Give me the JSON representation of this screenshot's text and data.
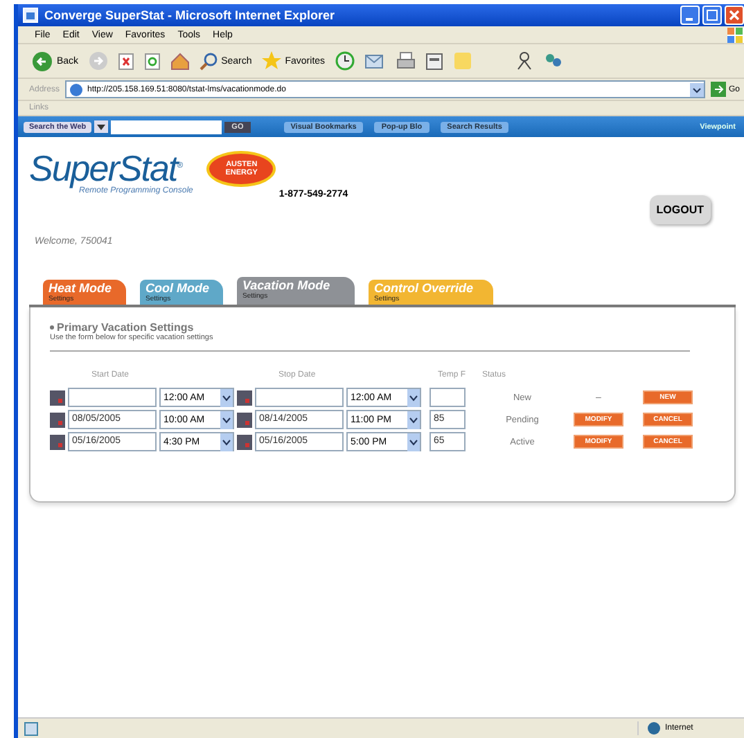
{
  "window": {
    "title": "Converge SuperStat - Microsoft Internet Explorer"
  },
  "menu": [
    "File",
    "Edit",
    "View",
    "Favorites",
    "Tools",
    "Help"
  ],
  "toolbar": {
    "back": "Back",
    "search": "Search",
    "favorites": "Favorites"
  },
  "address": {
    "label": "Address",
    "url": "http://205.158.169.51:8080/tstat-lms/vacationmode.do",
    "go": "Go"
  },
  "links": "Links",
  "search_toolbar": {
    "search_button": "Search the Web",
    "go": "GO",
    "items": [
      "Visual Bookmarks",
      "Pop-up Blo",
      "Search Results"
    ],
    "viewpoint": "Viewpoint"
  },
  "page": {
    "logo": "SuperStat$^{®}$",
    "logo_subtitle": "Remote Programming Console",
    "sponsor": "AUSTEN ENERGY",
    "phone": "1-877-549-2774",
    "logout": "LOGOUT",
    "welcome": "Welcome, 750041",
    "tabs": [
      {
        "label": "Heat Mode",
        "sub": "Settings",
        "color": "#e8692a",
        "selected": false
      },
      {
        "label": "Cool Mode",
        "sub": "Settings",
        "color": "#5fa8c8",
        "selected": false
      },
      {
        "label": "Vacation Mode",
        "sub": "Settings",
        "color": "#8e9196",
        "selected": true
      },
      {
        "label": "Control Override",
        "sub": "Settings",
        "color": "#f2b632",
        "selected": false
      }
    ],
    "section": {
      "title": "Primary Vacation Settings",
      "subtitle": "Use the form below for specific vacation settings"
    },
    "columns": [
      "Start Date",
      "Stop Date",
      "Temp F",
      "Status"
    ],
    "rows": [
      {
        "start_date": "",
        "start_time": "12:00 AM",
        "stop_date": "",
        "stop_time": "12:00 AM",
        "temp": "",
        "status": "New",
        "actions": [
          {
            "kind": "text",
            "label": "–"
          },
          {
            "kind": "button",
            "label": "NEW"
          }
        ]
      },
      {
        "start_date": "08/05/2005",
        "start_time": "10:00 AM",
        "stop_date": "08/14/2005",
        "stop_time": "11:00 PM",
        "temp": "85",
        "status": "Pending",
        "actions": [
          {
            "kind": "button",
            "label": "MODIFY"
          },
          {
            "kind": "button",
            "label": "CANCEL"
          }
        ]
      },
      {
        "start_date": "05/16/2005",
        "start_time": "4:30 PM",
        "stop_date": "05/16/2005",
        "stop_time": "5:00 PM",
        "temp": "65",
        "status": "Active",
        "actions": [
          {
            "kind": "button",
            "label": "MODIFY"
          },
          {
            "kind": "button",
            "label": "CANCEL"
          }
        ]
      }
    ]
  },
  "status_bar": {
    "zone": "Internet"
  }
}
